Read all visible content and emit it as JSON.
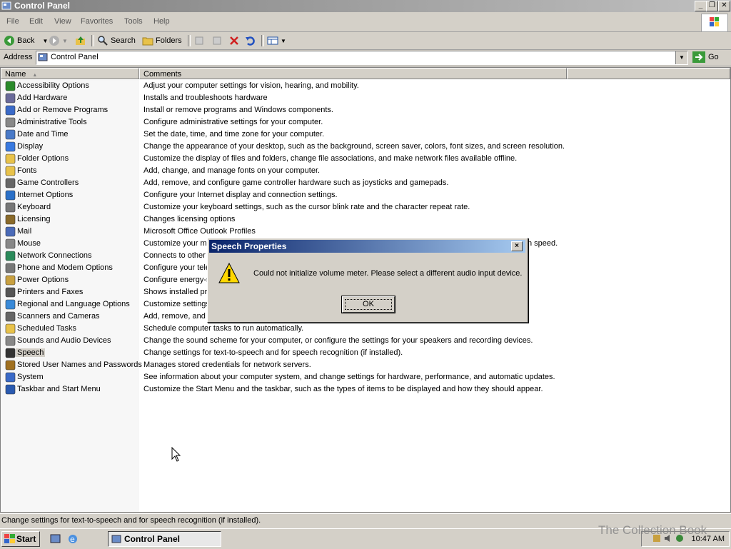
{
  "window": {
    "title": "Control Panel"
  },
  "menu": [
    "File",
    "Edit",
    "View",
    "Favorites",
    "Tools",
    "Help"
  ],
  "toolbar": {
    "back": "Back",
    "search": "Search",
    "folders": "Folders"
  },
  "address": {
    "label": "Address",
    "value": "Control Panel",
    "go": "Go"
  },
  "columns": {
    "name": "Name",
    "comments": "Comments"
  },
  "items": [
    {
      "name": "Accessibility Options",
      "comment": "Adjust your computer settings for vision, hearing, and mobility.",
      "icon": "accessibility-icon"
    },
    {
      "name": "Add Hardware",
      "comment": "Installs and troubleshoots hardware",
      "icon": "add-hardware-icon"
    },
    {
      "name": "Add or Remove Programs",
      "comment": "Install or remove programs and Windows components.",
      "icon": "add-remove-programs-icon"
    },
    {
      "name": "Administrative Tools",
      "comment": "Configure administrative settings for your computer.",
      "icon": "administrative-tools-icon"
    },
    {
      "name": "Date and Time",
      "comment": "Set the date, time, and time zone for your computer.",
      "icon": "date-time-icon"
    },
    {
      "name": "Display",
      "comment": "Change the appearance of your desktop, such as the background, screen saver, colors, font sizes, and screen resolution.",
      "icon": "display-icon"
    },
    {
      "name": "Folder Options",
      "comment": "Customize the display of files and folders, change file associations, and make network files available offline.",
      "icon": "folder-options-icon"
    },
    {
      "name": "Fonts",
      "comment": "Add, change, and manage fonts on your computer.",
      "icon": "fonts-icon"
    },
    {
      "name": "Game Controllers",
      "comment": "Add, remove, and configure game controller hardware such as joysticks and gamepads.",
      "icon": "game-controllers-icon"
    },
    {
      "name": "Internet Options",
      "comment": "Configure your Internet display and connection settings.",
      "icon": "internet-options-icon"
    },
    {
      "name": "Keyboard",
      "comment": "Customize your keyboard settings, such as the cursor blink rate and the character repeat rate.",
      "icon": "keyboard-icon"
    },
    {
      "name": "Licensing",
      "comment": "Changes licensing options",
      "icon": "licensing-icon"
    },
    {
      "name": "Mail",
      "comment": "Microsoft Office Outlook Profiles",
      "icon": "mail-icon"
    },
    {
      "name": "Mouse",
      "comment": "Customize your mo",
      "comment_tail": "n speed.",
      "icon": "mouse-icon"
    },
    {
      "name": "Network Connections",
      "comment": "Connects to other",
      "icon": "network-connections-icon"
    },
    {
      "name": "Phone and Modem Options",
      "comment": "Configure your tele",
      "icon": "phone-modem-icon"
    },
    {
      "name": "Power Options",
      "comment": "Configure energy-s",
      "icon": "power-options-icon"
    },
    {
      "name": "Printers and Faxes",
      "comment": "Shows installed prin",
      "icon": "printers-faxes-icon"
    },
    {
      "name": "Regional and Language Options",
      "comment": "Customize settings",
      "icon": "regional-language-icon"
    },
    {
      "name": "Scanners and Cameras",
      "comment": "Add, remove, and",
      "icon": "scanners-cameras-icon"
    },
    {
      "name": "Scheduled Tasks",
      "comment": "Schedule computer tasks to run automatically.",
      "icon": "scheduled-tasks-icon"
    },
    {
      "name": "Sounds and Audio Devices",
      "comment": "Change the sound scheme for your computer, or configure the settings for your speakers and recording devices.",
      "icon": "sounds-audio-icon"
    },
    {
      "name": "Speech",
      "comment": "Change settings for text-to-speech and for speech recognition (if installed).",
      "icon": "speech-icon",
      "selected": true
    },
    {
      "name": "Stored User Names and Passwords",
      "comment": "Manages stored credentials for network servers.",
      "icon": "stored-credentials-icon"
    },
    {
      "name": "System",
      "comment": "See information about your computer system, and change settings for hardware, performance, and automatic updates.",
      "icon": "system-icon"
    },
    {
      "name": "Taskbar and Start Menu",
      "comment": "Customize the Start Menu and the taskbar, such as the types of items to be displayed and how they should appear.",
      "icon": "taskbar-start-menu-icon"
    }
  ],
  "dialog": {
    "title": "Speech Properties",
    "message": "Could not initialize volume meter.  Please select a different audio input device.",
    "ok": "OK",
    "close": "×"
  },
  "status": {
    "text": "Change settings for text-to-speech and for speech recognition (if installed)."
  },
  "taskbar": {
    "start": "Start",
    "task": "Control Panel",
    "clock": "10:47 AM"
  },
  "watermark": "The Collection Book",
  "colors": {
    "dialog_title": "#0a246a",
    "window_bg": "#d4d0c8"
  }
}
